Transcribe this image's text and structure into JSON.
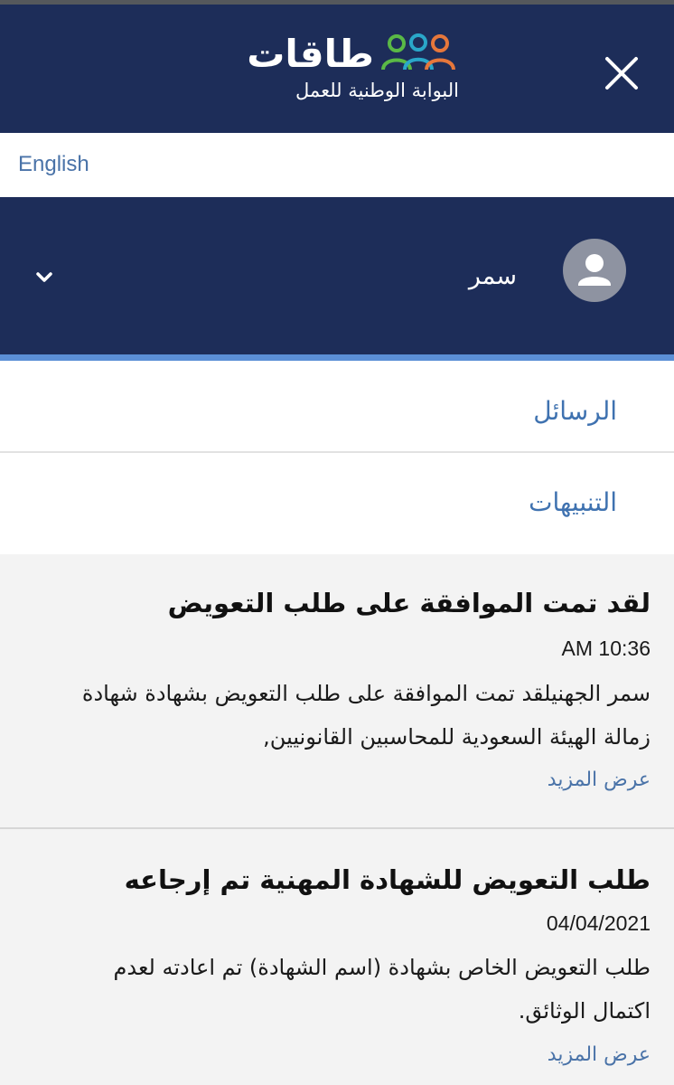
{
  "header": {
    "logo_word": "طاقات",
    "logo_tagline": "البوابة الوطنية للعمل",
    "people_colors": [
      "#5ab946",
      "#2aa7c9",
      "#e6773b"
    ],
    "close_icon": "close-icon"
  },
  "language": {
    "label": "English"
  },
  "user": {
    "name": "سمر",
    "avatar_icon": "user-icon",
    "expand_icon": "chevron-down-icon"
  },
  "nav": {
    "items": [
      {
        "label": "الرسائل"
      },
      {
        "label": "التنبيهات"
      }
    ]
  },
  "notifications": [
    {
      "title": "لقد تمت الموافقة على طلب التعويض",
      "time": "AM 10:36",
      "body_line1": "سمر الجهنيلقد تمت الموافقة على طلب التعويض بشهادة شهادة",
      "body_line2": "زمالة الهيئة السعودية للمحاسبين القانونيين,",
      "more": "عرض المزيد"
    },
    {
      "title": "طلب التعويض للشهادة المهنية تم إرجاعه",
      "time": "04/04/2021",
      "body_line1": "طلب التعويض الخاص بشهادة (اسم الشهادة) تم اعادته لعدم",
      "body_line2": "اكتمال الوثائق.",
      "more": "عرض المزيد"
    }
  ],
  "colors": {
    "navy": "#1d2d59",
    "accent_blue": "#5b8fd6",
    "link_blue": "#4a73a8",
    "list_bg": "#f3f3f3"
  }
}
